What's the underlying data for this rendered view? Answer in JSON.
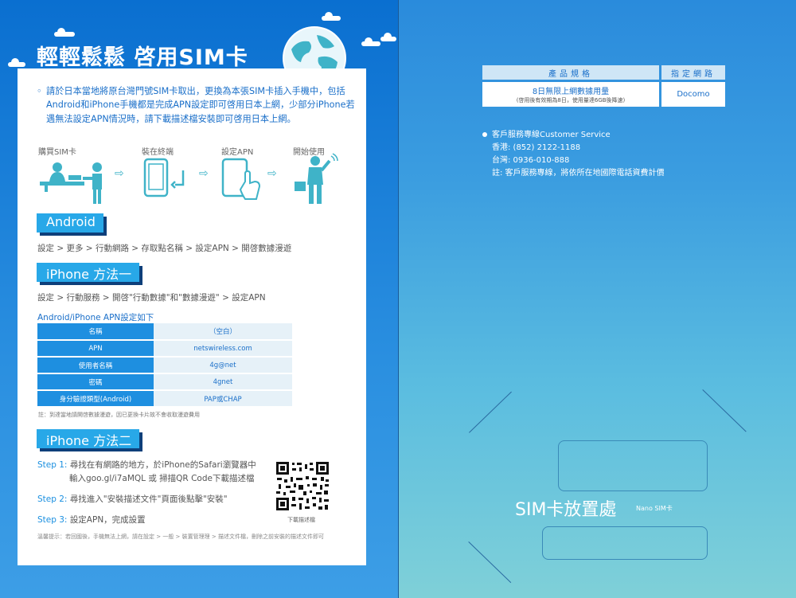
{
  "left": {
    "title": "輕輕鬆鬆  啓用SIM卡",
    "intro_bullet": "◦",
    "intro": "請於日本當地將原台灣門號SIM卡取出，更換為本張SIM卡插入手機中，包括Android和iPhone手機都是完成APN設定即可啓用日本上網，少部分iPhone若遇無法設定APN情況時，請下載描述檔安裝即可啓用日本上網。",
    "steps": [
      "購買SIM卡",
      "裝在終端",
      "設定APN",
      "開始使用"
    ],
    "android": {
      "tab": "Android",
      "path": "設定 > 更多 > 行動網路 > 存取點名稱 > 設定APN > 開啓數據漫遊"
    },
    "iphone1": {
      "tab": "iPhone 方法一",
      "path": "設定 > 行動服務 > 開啓\"行動數據\"和\"數據漫遊\" > 設定APN"
    },
    "apn": {
      "title": "Android/iPhone APN設定如下",
      "rows": [
        {
          "k": "名稱",
          "v": "（空白）"
        },
        {
          "k": "APN",
          "v": "netswireless.com"
        },
        {
          "k": "使用者名稱",
          "v": "4g@net"
        },
        {
          "k": "密碼",
          "v": "4gnet"
        },
        {
          "k": "身分驗證類型(Android)",
          "v": "PAP或CHAP"
        }
      ],
      "note": "註：到達當地請開啓數據漫遊，因已更換卡片故不會收取漫遊費用"
    },
    "iphone2": {
      "tab": "iPhone 方法二",
      "step1_label": "Step 1:",
      "step1_text": "尋找在有網路的地方，於iPhone的Safari瀏覽器中",
      "step1_sub": "輸入goo.gl/i7aMQL 或 掃描QR Code下載描述檔",
      "step2_label": "Step 2:",
      "step2_text": "尋找進入\"安裝描述文件\"頁面後點擊\"安裝\"",
      "step3_label": "Step 3:",
      "step3_text": "設定APN，完成設置",
      "qr_caption": "下載描述檔",
      "tip": "溫馨提示：若回國後，手機無法上網，請在設定 > 一般 > 裝置管理理 > 描述文件檔，刪除之前安裝的描述文件即可"
    }
  },
  "right": {
    "spec_headers": [
      "產品規格",
      "指定網路"
    ],
    "spec_main": "8日無限上網數據用量",
    "spec_sub": "(啓用後有效期為8日，使用量達6GB後降速)",
    "spec_network": "Docomo",
    "cs_title": "客戶服務專線Customer Service",
    "cs_lines": [
      "香港: (852) 2122-1188",
      "台灣: 0936-010-888",
      "註: 客戶服務專線，將依所在地國際電話資費計價"
    ],
    "sim_label": "SIM卡放置處",
    "sim_nano": "Nano SIM卡"
  },
  "colors": {
    "accent": "#28a8e8",
    "text_blue": "#1a6fc9",
    "dark_bar": "#0e3f7a"
  }
}
